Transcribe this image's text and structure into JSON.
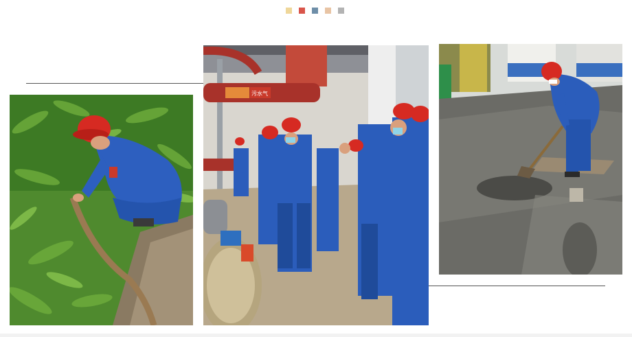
{
  "colors": {
    "dot_colors": [
      "#efd79a",
      "#d9554a",
      "#6e8ea8",
      "#e8c4a4",
      "#b3b3b3"
    ],
    "rule_color": "#555555"
  },
  "photos": [
    {
      "name": "photo-worker-inspecting-pipe-in-grass",
      "icon": "photo-grass-worker"
    },
    {
      "name": "photo-workers-inspection-group",
      "icon": "photo-plant-group"
    },
    {
      "name": "photo-worker-shoveling-wet-floor",
      "icon": "photo-wet-floor-worker"
    }
  ],
  "sign_text": "污水气"
}
